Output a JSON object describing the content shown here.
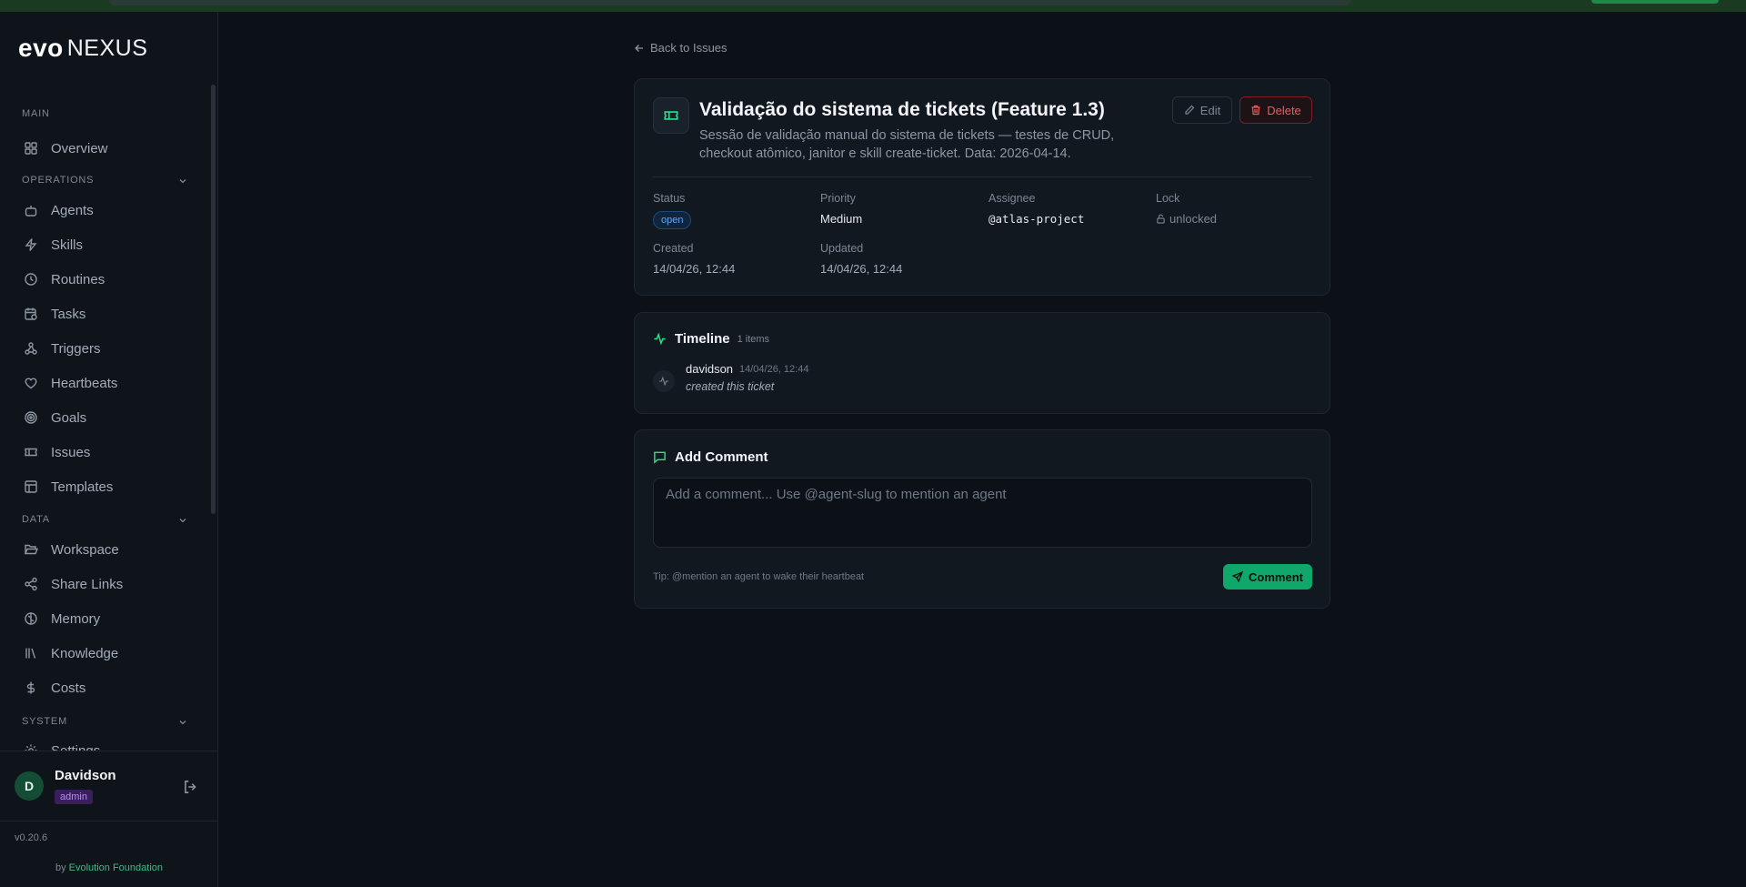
{
  "app": {
    "logo_evo": "evo",
    "logo_nexus": "NEXUS"
  },
  "sidebar": {
    "sections": {
      "main": "MAIN",
      "operations": "OPERATIONS",
      "data": "DATA",
      "system": "SYSTEM"
    },
    "items": {
      "overview": "Overview",
      "agents": "Agents",
      "skills": "Skills",
      "routines": "Routines",
      "tasks": "Tasks",
      "triggers": "Triggers",
      "heartbeats": "Heartbeats",
      "goals": "Goals",
      "issues": "Issues",
      "templates": "Templates",
      "workspace": "Workspace",
      "share_links": "Share Links",
      "memory": "Memory",
      "knowledge": "Knowledge",
      "costs": "Costs",
      "settings": "Settings"
    },
    "user": {
      "initial": "D",
      "name": "Davidson",
      "role": "admin"
    },
    "version": "v0.20.6",
    "credit_by": "by",
    "credit_org": "Evolution Foundation"
  },
  "main": {
    "back_label": "Back to Issues",
    "ticket": {
      "title": "Validação do sistema de tickets (Feature 1.3)",
      "description": "Sessão de validação manual do sistema de tickets — testes de CRUD, checkout atômico, janitor e skill create-ticket. Data: 2026-04-14.",
      "edit_label": "Edit",
      "delete_label": "Delete",
      "fields": {
        "status_label": "Status",
        "status_value": "open",
        "priority_label": "Priority",
        "priority_value": "Medium",
        "assignee_label": "Assignee",
        "assignee_value": "@atlas-project",
        "lock_label": "Lock",
        "lock_value": "unlocked",
        "created_label": "Created",
        "created_value": "14/04/26, 12:44",
        "updated_label": "Updated",
        "updated_value": "14/04/26, 12:44"
      }
    },
    "timeline": {
      "title": "Timeline",
      "count": "1 items",
      "entries": [
        {
          "user": "davidson",
          "time": "14/04/26, 12:44",
          "action": "created this ticket"
        }
      ]
    },
    "comment": {
      "title": "Add Comment",
      "placeholder": "Add a comment... Use @agent-slug to mention an agent",
      "tip": "Tip: @mention an agent to wake their heartbeat",
      "submit_label": "Comment"
    }
  },
  "colors": {
    "accent": "#2ee08a",
    "danger": "#ef5a5f",
    "status_open": "#5ea8f5",
    "admin": "#b58cf0"
  }
}
